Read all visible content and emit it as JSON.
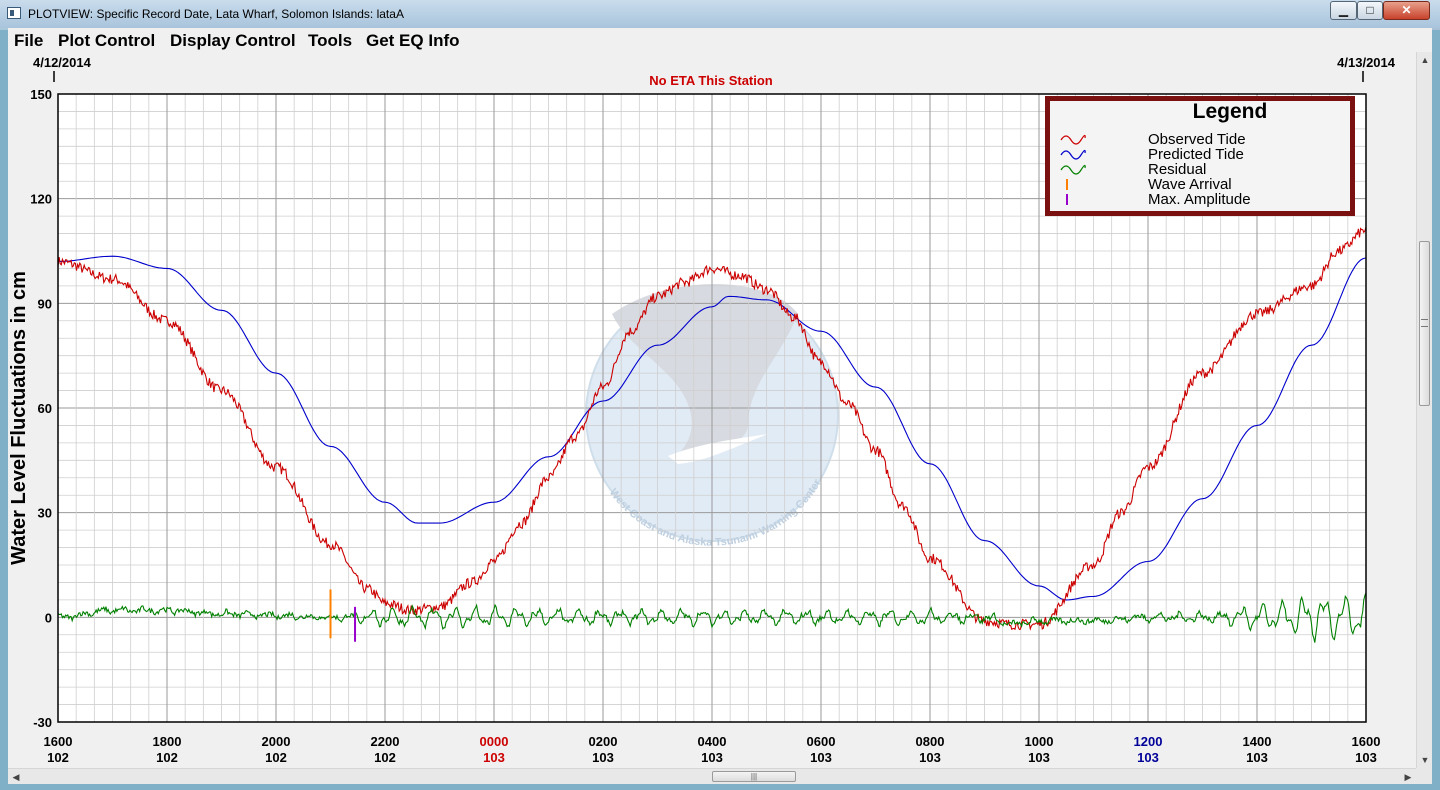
{
  "window": {
    "title": "PLOTVIEW: Specific Record Date, Lata Wharf, Solomon Islands: lataA",
    "minimize_glyph": "▁",
    "maximize_glyph": "□",
    "close_glyph": "✕"
  },
  "menu": [
    "File",
    "Plot Control",
    "Display Control",
    "Tools",
    "Get EQ Info"
  ],
  "scrollbar": {
    "grip_glyph": "≡",
    "hgrip_glyph": "|||",
    "up_glyph": "▲",
    "down_glyph": "▼",
    "left_glyph": "◀",
    "right_glyph": "▶"
  },
  "chart_data": {
    "type": "line",
    "date_left": "4/12/2014",
    "date_right": "4/13/2014",
    "eta_note": "No ETA This Station",
    "ylabel": "Water Level Fluctuations in cm",
    "ylim": [
      -30,
      150
    ],
    "y_ticks": [
      150,
      120,
      90,
      60,
      30,
      0,
      -30
    ],
    "grid": true,
    "xlim_hours": [
      16,
      40
    ],
    "x_ticks": [
      {
        "time": "1600",
        "day": "102",
        "color": "#000000"
      },
      {
        "time": "1800",
        "day": "102",
        "color": "#000000"
      },
      {
        "time": "2000",
        "day": "102",
        "color": "#000000"
      },
      {
        "time": "2200",
        "day": "102",
        "color": "#000000"
      },
      {
        "time": "0000",
        "day": "103",
        "color": "#cc0000"
      },
      {
        "time": "0200",
        "day": "103",
        "color": "#000000"
      },
      {
        "time": "0400",
        "day": "103",
        "color": "#000000"
      },
      {
        "time": "0600",
        "day": "103",
        "color": "#000000"
      },
      {
        "time": "0800",
        "day": "103",
        "color": "#000000"
      },
      {
        "time": "1000",
        "day": "103",
        "color": "#000000"
      },
      {
        "time": "1200",
        "day": "103",
        "color": "#000099"
      },
      {
        "time": "1400",
        "day": "103",
        "color": "#000000"
      },
      {
        "time": "1600",
        "day": "103",
        "color": "#000000"
      }
    ],
    "legend": {
      "title": "Legend",
      "placement": "top-right",
      "entries": [
        {
          "label": "Observed Tide",
          "color": "#cc0000",
          "symbol": "wave"
        },
        {
          "label": "Predicted Tide",
          "color": "#0000cc",
          "symbol": "wave"
        },
        {
          "label": "Residual",
          "color": "#008000",
          "symbol": "wave"
        },
        {
          "label": "Wave Arrival",
          "color": "#ff8000",
          "symbol": "tick"
        },
        {
          "label": "Max. Amplitude",
          "color": "#9900cc",
          "symbol": "tick"
        }
      ]
    },
    "series": [
      {
        "name": "Predicted Tide",
        "color": "#0000cc",
        "x_hours": [
          16.0,
          17.0,
          18.0,
          19.0,
          20.0,
          21.0,
          22.0,
          22.6,
          23.0,
          24.0,
          25.0,
          26.0,
          27.0,
          28.0,
          28.3,
          29.0,
          30.0,
          31.0,
          32.0,
          33.0,
          34.0,
          34.5,
          35.0,
          36.0,
          37.0,
          38.0,
          39.0,
          40.0
        ],
        "values": [
          102,
          103.5,
          100,
          88,
          70,
          49,
          33,
          27,
          27,
          33,
          46,
          62,
          78,
          89,
          92,
          91,
          82,
          66,
          44,
          22,
          9,
          5,
          6,
          16,
          34,
          55,
          78,
          103
        ]
      },
      {
        "name": "Observed Tide",
        "color": "#cc0000",
        "noise": 1.5,
        "x_hours": [
          16.0,
          17.0,
          18.0,
          19.0,
          20.0,
          21.0,
          21.7,
          22.0,
          22.5,
          23.0,
          23.6,
          24.0,
          24.5,
          25.0,
          25.5,
          26.0,
          26.5,
          27.0,
          27.5,
          28.0,
          28.5,
          29.0,
          29.5,
          30.0,
          30.5,
          31.0,
          31.5,
          32.0,
          33.0,
          33.5,
          34.0,
          35.0,
          35.5,
          36.0,
          37.0,
          38.0,
          39.0,
          39.5,
          40.0
        ],
        "values": [
          102,
          97,
          85,
          65,
          43,
          21,
          8,
          4,
          2,
          3,
          10,
          16,
          27,
          40,
          52,
          66,
          82,
          92,
          96,
          100,
          98,
          94,
          86,
          73,
          61,
          48,
          32,
          17,
          -1,
          -2,
          -2,
          15,
          30,
          43,
          70,
          87,
          95,
          105,
          111
        ]
      },
      {
        "name": "Residual",
        "color": "#008000",
        "noise": 0.7,
        "x_hours": [
          16.0,
          17.0,
          18.0,
          19.0,
          20.0,
          21.0,
          22.0,
          24.0,
          26.0,
          28.0,
          30.0,
          32.0,
          33.0,
          33.5,
          34.0,
          35.0,
          36.0,
          37.0,
          38.0,
          39.0,
          40.0
        ],
        "values": [
          0,
          2,
          2,
          1,
          0.5,
          0,
          0,
          0,
          0,
          0,
          0,
          0,
          0,
          -2,
          -1,
          -1,
          0,
          0,
          0,
          0,
          0
        ],
        "oscillation_amplitude": [
          0.5,
          0.5,
          0.5,
          0.5,
          0.5,
          0.5,
          2.0,
          2.0,
          1.5,
          1.5,
          1.5,
          1.5,
          1.0,
          0.5,
          0.5,
          0.5,
          0.8,
          1.0,
          2.5,
          4.5,
          4.5
        ]
      }
    ],
    "markers": [
      {
        "name": "Wave Arrival",
        "x_hours": 21.0,
        "y_range": [
          -6,
          8
        ],
        "color": "#ff8000"
      },
      {
        "name": "Max. Amplitude",
        "x_hours": 21.45,
        "y_range": [
          -7,
          3
        ],
        "color": "#9900cc"
      }
    ],
    "watermark": {
      "arc_text": "West Coast and Alaska Tsunami Warning Center"
    }
  }
}
